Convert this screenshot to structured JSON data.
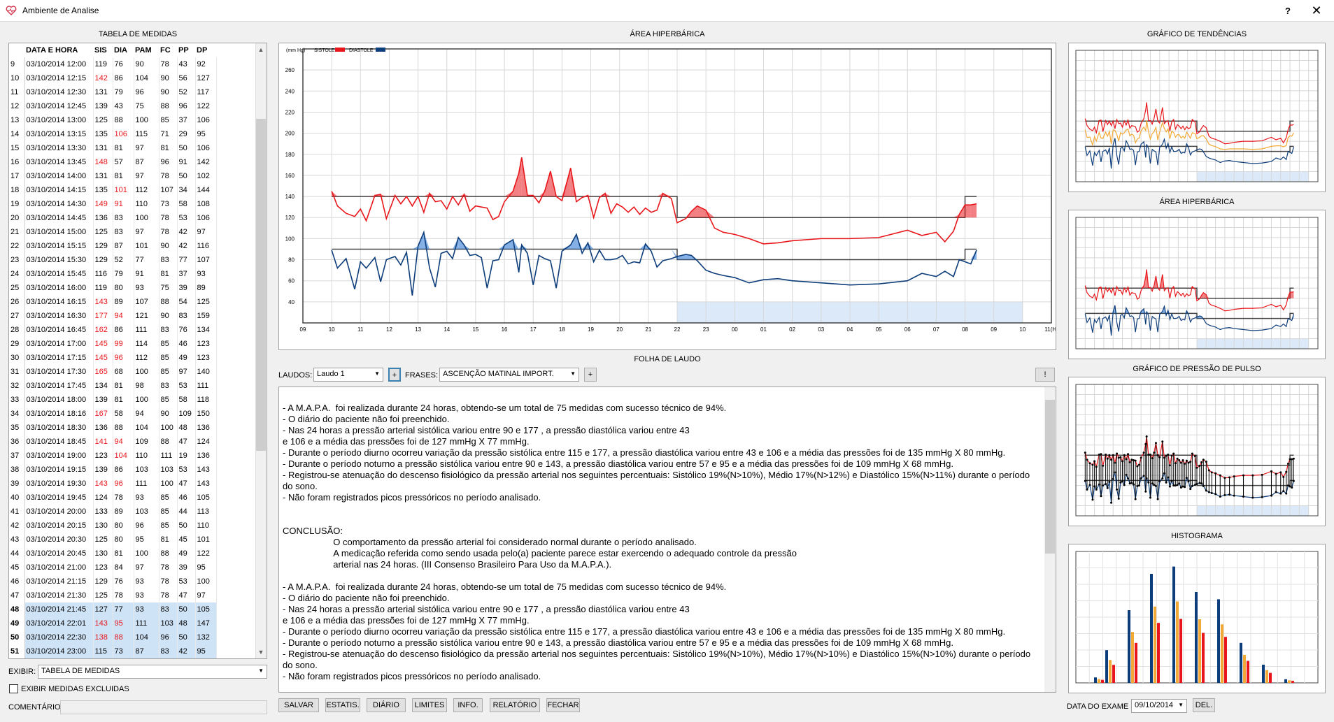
{
  "window": {
    "title": "Ambiente de Analise",
    "help": "?",
    "close": "✕"
  },
  "sections": {
    "table": "TABELA DE MEDIDAS",
    "hyper": "ÁREA HIPERBÁRICA",
    "trends": "GRÁFICO DE TENDÊNCIAS",
    "hyper_small": "ÁREA HIPERBÁRICA",
    "pulse": "GRÁFICO DE PRESSÃO DE PULSO",
    "histogram": "HISTOGRAMA",
    "folha": "FOLHA DE LAUDO"
  },
  "table": {
    "headers": [
      "",
      "DATA E HORA",
      "SIS",
      "DIA",
      "PAM",
      "FC",
      "PP",
      "DP"
    ],
    "rows": [
      [
        "9",
        "03/10/2014 12:00",
        "119",
        "76",
        "90",
        "78",
        "43",
        "92"
      ],
      [
        "10",
        "03/10/2014 12:15",
        "142",
        "86",
        "104",
        "90",
        "56",
        "127"
      ],
      [
        "11",
        "03/10/2014 12:30",
        "131",
        "79",
        "96",
        "90",
        "52",
        "117"
      ],
      [
        "12",
        "03/10/2014 12:45",
        "139",
        "43",
        "75",
        "88",
        "96",
        "122"
      ],
      [
        "13",
        "03/10/2014 13:00",
        "125",
        "88",
        "100",
        "85",
        "37",
        "106"
      ],
      [
        "14",
        "03/10/2014 13:15",
        "135",
        "106",
        "115",
        "71",
        "29",
        "95"
      ],
      [
        "15",
        "03/10/2014 13:30",
        "131",
        "81",
        "97",
        "81",
        "50",
        "106"
      ],
      [
        "16",
        "03/10/2014 13:45",
        "148",
        "57",
        "87",
        "96",
        "91",
        "142"
      ],
      [
        "17",
        "03/10/2014 14:00",
        "131",
        "81",
        "97",
        "78",
        "50",
        "102"
      ],
      [
        "18",
        "03/10/2014 14:15",
        "135",
        "101",
        "112",
        "107",
        "34",
        "144"
      ],
      [
        "19",
        "03/10/2014 14:30",
        "149",
        "91",
        "110",
        "73",
        "58",
        "108"
      ],
      [
        "20",
        "03/10/2014 14:45",
        "136",
        "83",
        "100",
        "78",
        "53",
        "106"
      ],
      [
        "21",
        "03/10/2014 15:00",
        "125",
        "83",
        "97",
        "78",
        "42",
        "97"
      ],
      [
        "22",
        "03/10/2014 15:15",
        "129",
        "87",
        "101",
        "90",
        "42",
        "116"
      ],
      [
        "23",
        "03/10/2014 15:30",
        "129",
        "52",
        "77",
        "83",
        "77",
        "107"
      ],
      [
        "24",
        "03/10/2014 15:45",
        "116",
        "79",
        "91",
        "81",
        "37",
        "93"
      ],
      [
        "25",
        "03/10/2014 16:00",
        "119",
        "80",
        "93",
        "75",
        "39",
        "89"
      ],
      [
        "26",
        "03/10/2014 16:15",
        "143",
        "89",
        "107",
        "88",
        "54",
        "125"
      ],
      [
        "27",
        "03/10/2014 16:30",
        "177",
        "94",
        "121",
        "90",
        "83",
        "159"
      ],
      [
        "28",
        "03/10/2014 16:45",
        "162",
        "86",
        "111",
        "83",
        "76",
        "134"
      ],
      [
        "29",
        "03/10/2014 17:00",
        "145",
        "99",
        "114",
        "85",
        "46",
        "123"
      ],
      [
        "30",
        "03/10/2014 17:15",
        "145",
        "96",
        "112",
        "85",
        "49",
        "123"
      ],
      [
        "31",
        "03/10/2014 17:30",
        "165",
        "68",
        "100",
        "85",
        "97",
        "140"
      ],
      [
        "32",
        "03/10/2014 17:45",
        "134",
        "81",
        "98",
        "83",
        "53",
        "111"
      ],
      [
        "33",
        "03/10/2014 18:00",
        "139",
        "81",
        "100",
        "85",
        "58",
        "118"
      ],
      [
        "34",
        "03/10/2014 18:16",
        "167",
        "58",
        "94",
        "90",
        "109",
        "150"
      ],
      [
        "35",
        "03/10/2014 18:30",
        "136",
        "88",
        "104",
        "100",
        "48",
        "136"
      ],
      [
        "36",
        "03/10/2014 18:45",
        "141",
        "94",
        "109",
        "88",
        "47",
        "124"
      ],
      [
        "37",
        "03/10/2014 19:00",
        "123",
        "104",
        "110",
        "111",
        "19",
        "136"
      ],
      [
        "38",
        "03/10/2014 19:15",
        "139",
        "86",
        "103",
        "103",
        "53",
        "143"
      ],
      [
        "39",
        "03/10/2014 19:30",
        "143",
        "96",
        "111",
        "100",
        "47",
        "143"
      ],
      [
        "40",
        "03/10/2014 19:45",
        "124",
        "78",
        "93",
        "85",
        "46",
        "105"
      ],
      [
        "41",
        "03/10/2014 20:00",
        "133",
        "89",
        "103",
        "85",
        "44",
        "113"
      ],
      [
        "42",
        "03/10/2014 20:15",
        "130",
        "80",
        "96",
        "85",
        "50",
        "110"
      ],
      [
        "43",
        "03/10/2014 20:30",
        "125",
        "80",
        "95",
        "81",
        "45",
        "101"
      ],
      [
        "44",
        "03/10/2014 20:45",
        "130",
        "81",
        "100",
        "88",
        "49",
        "122"
      ],
      [
        "45",
        "03/10/2014 21:00",
        "123",
        "84",
        "97",
        "78",
        "39",
        "95"
      ],
      [
        "46",
        "03/10/2014 21:15",
        "129",
        "76",
        "93",
        "78",
        "53",
        "100"
      ],
      [
        "47",
        "03/10/2014 21:30",
        "125",
        "78",
        "93",
        "78",
        "47",
        "97"
      ],
      [
        "48",
        "03/10/2014 21:45",
        "127",
        "77",
        "93",
        "83",
        "50",
        "105"
      ],
      [
        "49",
        "03/10/2014 22:01",
        "143",
        "95",
        "111",
        "103",
        "48",
        "147"
      ],
      [
        "50",
        "03/10/2014 22:30",
        "138",
        "88",
        "104",
        "96",
        "50",
        "132"
      ],
      [
        "51",
        "03/10/2014 23:00",
        "115",
        "73",
        "87",
        "83",
        "42",
        "95"
      ]
    ],
    "red_cells": {
      "10": [
        2
      ],
      "14": [
        3
      ],
      "16": [
        2
      ],
      "18": [
        3
      ],
      "19": [
        2,
        3
      ],
      "26": [
        2
      ],
      "27": [
        2,
        3
      ],
      "28": [
        2
      ],
      "29": [
        2,
        3
      ],
      "30": [
        2,
        3
      ],
      "31": [
        2
      ],
      "34": [
        2
      ],
      "36": [
        2,
        3
      ],
      "37": [
        3
      ],
      "39": [
        2,
        3
      ],
      "49": [
        2,
        3
      ],
      "50": [
        2,
        3
      ]
    },
    "selected_rows": [
      "48",
      "49",
      "50",
      "51"
    ]
  },
  "controls": {
    "exibir_label": "EXIBIR:",
    "exibir_value": "TABELA DE MEDIDAS",
    "excluded_label": "EXIBIR MEDIDAS EXCLUIDAS",
    "comentario_label": "COMENTÁRIO",
    "laudos_label": "LAUDOS:",
    "laudos_value": "Laudo 1",
    "plus": "+",
    "frases_label": "FRASES:",
    "frases_value": "ASCENÇÃO MATINAL IMPORT.",
    "excl": "!",
    "data_exame_label": "DATA DO EXAME :",
    "data_exame_value": "09/10/2014",
    "del": "DEL."
  },
  "buttons": [
    "SALVAR",
    "ESTATIS.",
    "DIÁRIO",
    "LIMITES",
    "INFO.",
    "RELATÓRIO",
    "FECHAR"
  ],
  "laudo_text": "- A M.A.P.A.  foi realizada durante 24 horas, obtendo-se um total de 75 medidas com sucesso técnico de 94%.\n- O diário do paciente não foi preenchido.\n- Nas 24 horas a pressão arterial sistólica variou entre 90 e 177 , a pressão diastólica variou entre 43\ne 106 e a média das pressões foi de 127 mmHg X 77 mmHg.\n- Durante o período diurno ocorreu variação da pressão sistólica entre 115 e 177, a pressão diastólica variou entre 43 e 106 e a média das pressões foi de 135 mmHg X 80 mmHg.\n- Durante o período noturno a pressão sistólica variou entre 90 e 143, a pressão diastólica variou entre 57 e 95 e a média das pressões foi de 109 mmHg X 68 mmHg.\n- Registrou-se atenuação do descenso fisiológico da pressão arterial nos seguintes percentuais: Sistólico 19%(N>10%), Médio 17%(N>12%) e Diastólico 15%(N>11%) durante o período\ndo sono.\n- Não foram registrados picos pressóricos no período analisado.\n\n\nCONCLUSÃO:\n                    O comportamento da pressão arterial foi considerado normal durante o período analisado.\n                    A medicação referida como sendo usada pelo(a) paciente parece estar exercendo o adequado controle da pressão\n                    arterial nas 24 horas. (III Consenso Brasileiro Para Uso da M.A.P.A.).\n\n- A M.A.P.A.  foi realizada durante 24 horas, obtendo-se um total de 75 medidas com sucesso técnico de 94%.\n- O diário do paciente não foi preenchido.\n- Nas 24 horas a pressão arterial sistólica variou entre 90 e 177 , a pressão diastólica variou entre 43\ne 106 e a média das pressões foi de 127 mmHg X 77 mmHg.\n- Durante o período diurno ocorreu variação da pressão sistólica entre 115 e 177, a pressão diastólica variou entre 43 e 106 e a média das pressões foi de 135 mmHg X 80 mmHg.\n- Durante o período noturno a pressão sistólica variou entre 90 e 143, a pressão diastólica variou entre 57 e 95 e a média das pressões foi de 109 mmHg X 68 mmHg.\n- Registrou-se atenuação do descenso fisiológico da pressão arterial nos seguintes percentuais: Sistólico 19%(N>10%), Médio 17%(N>10%) e Diastólico 15%(N>10%) durante o período\ndo sono.\n- Não foram registrados picos pressóricos no período analisado.",
  "chart_data": {
    "type": "line",
    "unit_label": "(mm Hg)",
    "series_names": [
      "SISTOLE",
      "DIASTOLE"
    ],
    "colors": {
      "sis": "#e8161b",
      "dia": "#0d3d7a",
      "limit": "#444444",
      "sleep": "#dbe9f9"
    },
    "x_ticks": [
      "09",
      "10",
      "11",
      "12",
      "13",
      "14",
      "15",
      "16",
      "17",
      "18",
      "19",
      "20",
      "21",
      "22",
      "23",
      "00",
      "01",
      "02",
      "03",
      "04",
      "05",
      "06",
      "07",
      "08",
      "09",
      "10",
      "11(H)"
    ],
    "y_ticks": [
      40,
      60,
      80,
      100,
      120,
      140,
      160,
      180,
      200,
      220,
      240,
      260
    ],
    "ylim": [
      20,
      280
    ],
    "sys": [
      [
        10,
        145
      ],
      [
        10.2,
        131
      ],
      [
        10.5,
        124
      ],
      [
        10.8,
        121
      ],
      [
        11,
        128
      ],
      [
        11.2,
        117
      ],
      [
        11.5,
        141
      ],
      [
        11.7,
        142
      ],
      [
        11.9,
        119
      ],
      [
        12.2,
        141
      ],
      [
        12.4,
        133
      ],
      [
        12.6,
        140
      ],
      [
        12.8,
        131
      ],
      [
        13,
        140
      ],
      [
        13.2,
        125
      ],
      [
        13.4,
        143
      ],
      [
        13.6,
        135
      ],
      [
        13.8,
        136
      ],
      [
        14,
        128
      ],
      [
        14.2,
        140
      ],
      [
        14.4,
        132
      ],
      [
        14.6,
        142
      ],
      [
        14.8,
        126
      ],
      [
        15,
        131
      ],
      [
        15.2,
        130
      ],
      [
        15.4,
        129
      ],
      [
        15.6,
        118
      ],
      [
        15.8,
        121
      ],
      [
        16,
        135
      ],
      [
        16.3,
        145
      ],
      [
        16.5,
        162
      ],
      [
        16.6,
        177
      ],
      [
        16.8,
        141
      ],
      [
        17,
        141
      ],
      [
        17.2,
        134
      ],
      [
        17.4,
        145
      ],
      [
        17.6,
        164
      ],
      [
        17.8,
        140
      ],
      [
        18,
        136
      ],
      [
        18.3,
        167
      ],
      [
        18.5,
        135
      ],
      [
        18.7,
        139
      ],
      [
        18.9,
        141
      ],
      [
        19.1,
        120
      ],
      [
        19.3,
        139
      ],
      [
        19.5,
        143
      ],
      [
        19.7,
        124
      ],
      [
        19.9,
        133
      ],
      [
        20.1,
        130
      ],
      [
        20.3,
        125
      ],
      [
        20.5,
        130
      ],
      [
        20.7,
        123
      ],
      [
        20.9,
        129
      ],
      [
        21.1,
        125
      ],
      [
        21.3,
        127
      ],
      [
        21.5,
        143
      ],
      [
        21.8,
        138
      ],
      [
        22,
        115
      ],
      [
        22.3,
        119
      ],
      [
        22.5,
        126
      ],
      [
        22.7,
        131
      ],
      [
        23,
        127
      ],
      [
        23.3,
        110
      ],
      [
        23.6,
        106
      ],
      [
        24,
        104
      ],
      [
        24.5,
        100
      ],
      [
        25,
        95
      ],
      [
        25.5,
        96
      ],
      [
        26,
        98
      ],
      [
        27,
        100
      ],
      [
        28,
        100
      ],
      [
        29,
        101
      ],
      [
        30,
        108
      ],
      [
        30.5,
        103
      ],
      [
        31,
        106
      ],
      [
        31.3,
        97
      ],
      [
        31.6,
        107
      ],
      [
        31.8,
        123
      ],
      [
        32,
        132
      ],
      [
        32.2,
        132
      ],
      [
        32.4,
        133
      ]
    ],
    "dia": [
      [
        10,
        89
      ],
      [
        10.2,
        72
      ],
      [
        10.5,
        81
      ],
      [
        10.8,
        52
      ],
      [
        11,
        78
      ],
      [
        11.2,
        72
      ],
      [
        11.5,
        82
      ],
      [
        11.7,
        59
      ],
      [
        11.9,
        80
      ],
      [
        12.2,
        83
      ],
      [
        12.4,
        75
      ],
      [
        12.6,
        87
      ],
      [
        12.8,
        46
      ],
      [
        13,
        93
      ],
      [
        13.2,
        106
      ],
      [
        13.4,
        72
      ],
      [
        13.6,
        54
      ],
      [
        13.8,
        86
      ],
      [
        14,
        88
      ],
      [
        14.2,
        81
      ],
      [
        14.4,
        101
      ],
      [
        14.6,
        94
      ],
      [
        14.8,
        84
      ],
      [
        15,
        85
      ],
      [
        15.2,
        82
      ],
      [
        15.4,
        53
      ],
      [
        15.6,
        79
      ],
      [
        15.8,
        80
      ],
      [
        16,
        94
      ],
      [
        16.3,
        99
      ],
      [
        16.5,
        68
      ],
      [
        16.6,
        94
      ],
      [
        16.8,
        86
      ],
      [
        17,
        56
      ],
      [
        17.2,
        84
      ],
      [
        17.4,
        81
      ],
      [
        17.6,
        79
      ],
      [
        17.8,
        53
      ],
      [
        18,
        88
      ],
      [
        18.3,
        94
      ],
      [
        18.5,
        104
      ],
      [
        18.7,
        86
      ],
      [
        18.9,
        96
      ],
      [
        19.1,
        78
      ],
      [
        19.3,
        89
      ],
      [
        19.5,
        80
      ],
      [
        19.7,
        80
      ],
      [
        19.9,
        81
      ],
      [
        20.1,
        84
      ],
      [
        20.3,
        76
      ],
      [
        20.5,
        78
      ],
      [
        20.7,
        77
      ],
      [
        20.9,
        95
      ],
      [
        21.1,
        88
      ],
      [
        21.3,
        73
      ],
      [
        21.5,
        79
      ],
      [
        21.8,
        81
      ],
      [
        22,
        83
      ],
      [
        22.3,
        85
      ],
      [
        22.5,
        84
      ],
      [
        22.7,
        79
      ],
      [
        23,
        70
      ],
      [
        23.3,
        67
      ],
      [
        23.6,
        65
      ],
      [
        24,
        63
      ],
      [
        24.5,
        58
      ],
      [
        25,
        61
      ],
      [
        25.5,
        62
      ],
      [
        26,
        60
      ],
      [
        27,
        58
      ],
      [
        28,
        56
      ],
      [
        29,
        57
      ],
      [
        30,
        60
      ],
      [
        30.5,
        67
      ],
      [
        31,
        64
      ],
      [
        31.3,
        69
      ],
      [
        31.6,
        64
      ],
      [
        31.8,
        80
      ],
      [
        32,
        78
      ],
      [
        32.2,
        76
      ],
      [
        32.4,
        89
      ]
    ],
    "limits": {
      "sys_day": 140,
      "sys_night": 120,
      "dia_day": 90,
      "dia_night": 80,
      "night_start": 22,
      "night_end": 34
    },
    "sleep": [
      22,
      34
    ],
    "hist_values": [
      [
        1,
        3
      ],
      [
        2,
        18
      ],
      [
        4,
        40
      ],
      [
        6,
        60
      ],
      [
        8,
        64
      ],
      [
        10,
        50
      ],
      [
        12,
        46
      ],
      [
        14,
        22
      ],
      [
        16,
        10
      ],
      [
        18,
        2
      ]
    ]
  }
}
